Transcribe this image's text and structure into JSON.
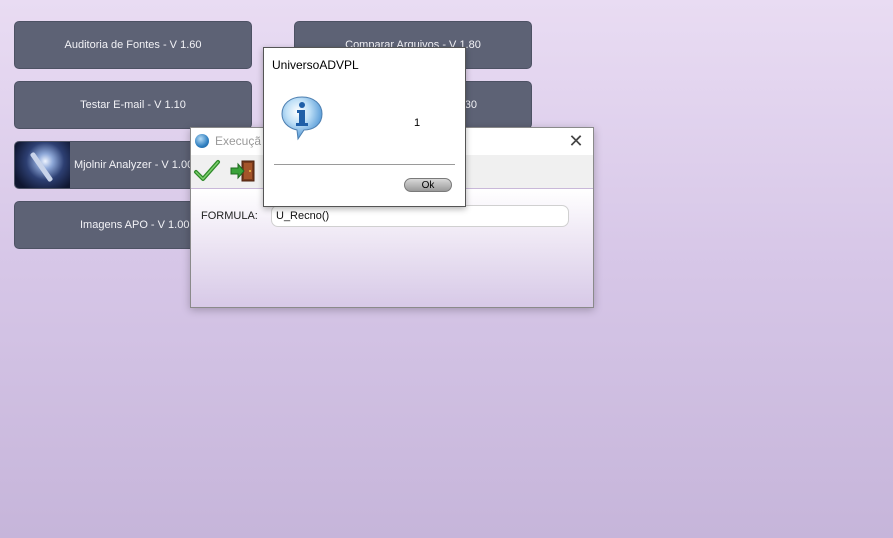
{
  "tiles": [
    {
      "label": "Auditoria de Fontes - V 1.60"
    },
    {
      "label": "Comparar Arquivos - V 1.80"
    },
    {
      "label": "Testar E-mail - V 1.10"
    },
    {
      "label": "30"
    },
    {
      "label": "Mjolnir Analyzer - V 1.00"
    },
    {
      "label": "Imagens APO - V 1.00"
    }
  ],
  "exec_dialog": {
    "title": "Execuçã",
    "close_glyph": "✕",
    "formula_label": "FORMULA:",
    "formula_value": "U_Recno()"
  },
  "message_box": {
    "title": "UniversoADVPL",
    "message": "1",
    "ok_label": "Ok"
  },
  "colors": {
    "tile_bg": "#5d6275",
    "confirm_green": "#2f8a2a",
    "info_blue": "#2a78c8"
  }
}
